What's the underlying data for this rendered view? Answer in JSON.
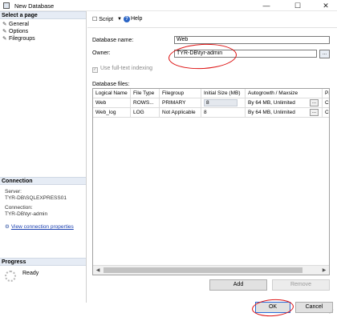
{
  "window": {
    "title": "New Database",
    "min_glyph": "—",
    "max_glyph": "☐",
    "close_glyph": "✕"
  },
  "left_pane": {
    "select_page_header": "Select a page",
    "pages": [
      {
        "label": "General",
        "icon": "wrench-icon"
      },
      {
        "label": "Options",
        "icon": "wrench-icon"
      },
      {
        "label": "Filegroups",
        "icon": "wrench-icon"
      }
    ],
    "connection_header": "Connection",
    "server_label": "Server:",
    "server_value": "TYR-DB\\SQLEXPRESS01",
    "connection_label": "Connection:",
    "connection_value": "TYR-DB\\tyr-admin",
    "view_props_link": "View connection properties",
    "progress_header": "Progress",
    "progress_status": "Ready"
  },
  "toolbar": {
    "script_label": "Script",
    "dropdown_glyph": "▼",
    "help_label": "Help"
  },
  "general": {
    "db_name_label": "Database name:",
    "db_name_value": "Web",
    "owner_label": "Owner:",
    "owner_value": "TYR-DB\\tyr-admin",
    "browse_label": "...",
    "fulltext_label": "Use full-text indexing",
    "files_label": "Database files:"
  },
  "files_table": {
    "columns": [
      "Logical Name",
      "File Type",
      "Filegroup",
      "Initial Size (MB)",
      "Autogrowth / Maxsize",
      "Pa"
    ],
    "rows": [
      {
        "logical_name": "Web",
        "file_type": "ROWS...",
        "filegroup": "PRIMARY",
        "initial_size": "8",
        "autogrowth": "By 64 MB, Unlimited",
        "path": "C:"
      },
      {
        "logical_name": "Web_log",
        "file_type": "LOG",
        "filegroup": "Not Applicable",
        "initial_size": "8",
        "autogrowth": "By 64 MB, Unlimited",
        "path": "C:"
      }
    ],
    "ellipsis": "..."
  },
  "buttons": {
    "add": "Add",
    "remove": "Remove",
    "ok": "OK",
    "cancel": "Cancel"
  },
  "colors": {
    "annotation_red": "#dd1111",
    "link_blue": "#1a3fb0",
    "header_bg": "#e6ecf5"
  }
}
